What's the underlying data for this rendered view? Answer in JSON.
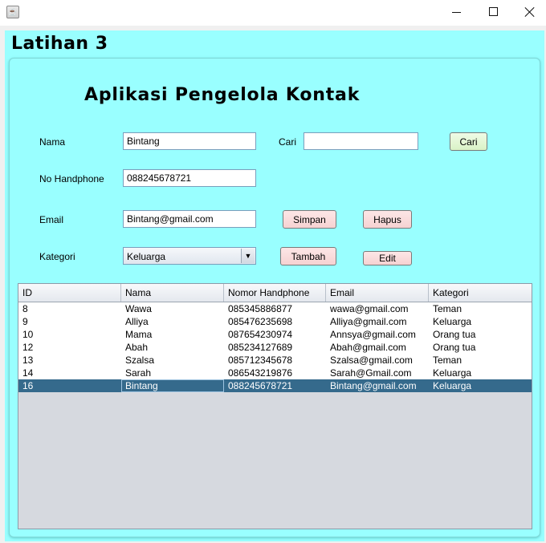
{
  "window": {
    "app_icon": "java-icon",
    "controls": [
      "minimize-icon",
      "maximize-icon",
      "close-icon"
    ]
  },
  "frame_title": "Latihan 3",
  "heading": "Aplikasi Pengelola Kontak",
  "form": {
    "nama_label": "Nama",
    "nama_value": "Bintang",
    "no_hp_label": "No Handphone",
    "no_hp_value": "088245678721",
    "email_label": "Email",
    "email_value": "Bintang@gmail.com",
    "kategori_label": "Kategori",
    "kategori_value": "Keluarga",
    "cari_label": "Cari",
    "cari_value": ""
  },
  "buttons": {
    "cari": "Cari",
    "simpan": "Simpan",
    "hapus": "Hapus",
    "tambah": "Tambah",
    "edit": "Edit"
  },
  "table": {
    "columns": [
      "ID",
      "Nama",
      "Nomor Handphone",
      "Email",
      "Kategori"
    ],
    "rows": [
      [
        "8",
        "Wawa",
        "085345886877",
        "wawa@gmail.com",
        "Teman"
      ],
      [
        "9",
        "Alliya",
        "085476235698",
        "Alliya@gmail.com",
        "Keluarga"
      ],
      [
        "10",
        "Mama",
        "087654230974",
        "Annsya@gmail.com",
        "Orang tua"
      ],
      [
        "12",
        "Abah",
        "085234127689",
        "Abah@gmail.com",
        "Orang tua"
      ],
      [
        "13",
        "Szalsa",
        "085712345678",
        "Szalsa@gmail.com",
        "Teman"
      ],
      [
        "14",
        "Sarah",
        "086543219876",
        "Sarah@Gmail.com",
        "Keluarga"
      ],
      [
        "16",
        "Bintang",
        "088245678721",
        "Bintang@gmail.com",
        "Keluarga"
      ]
    ],
    "selected_row": 6
  },
  "colors": {
    "panel_bg": "#99ffff",
    "selection": "#356a8c"
  }
}
